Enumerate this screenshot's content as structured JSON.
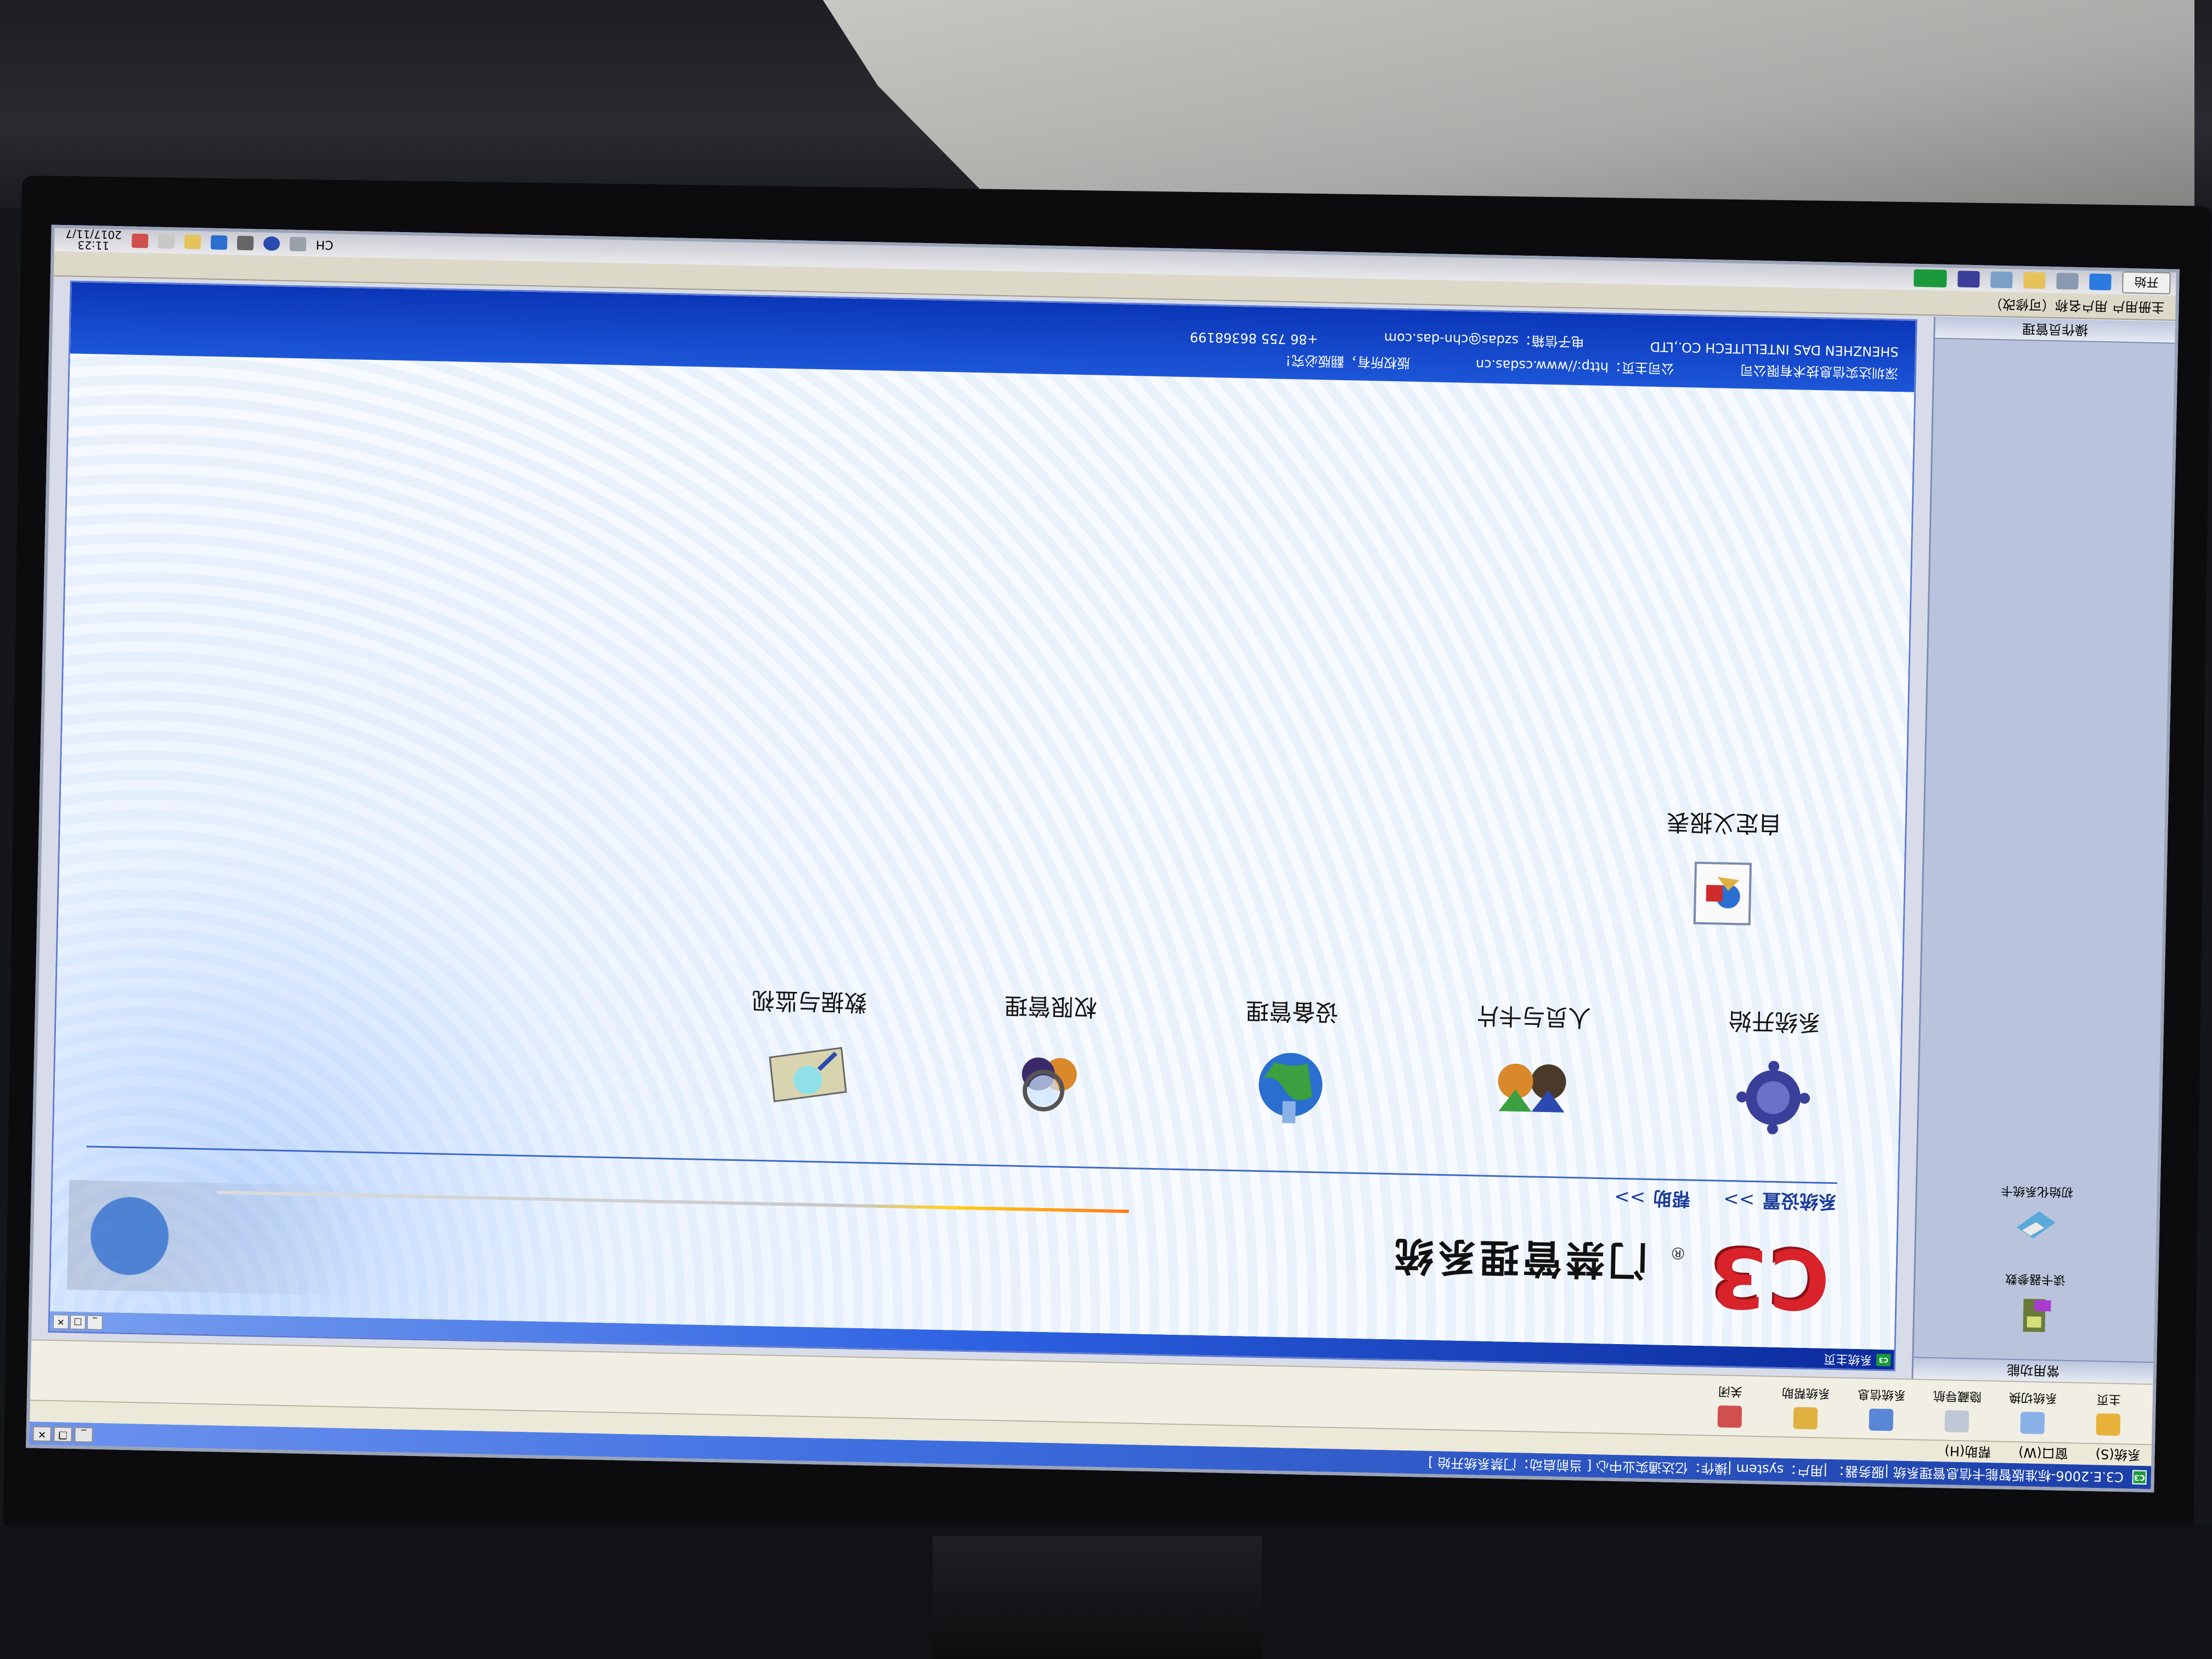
{
  "app": {
    "title": "C3.E.2006-标准版智能卡信息管理系统  |服务器：  |用户：system  |操作：亿达通实业中心    [ 当前启动：门禁系统开始 ]",
    "logo_text": "C3"
  },
  "menu": [
    "系统(S)",
    "窗口(W)",
    "帮助(H)"
  ],
  "toolbar": [
    {
      "label": "主页",
      "icon": "home-icon",
      "color": "#e6b23a"
    },
    {
      "label": "系统切换",
      "icon": "switch-icon",
      "color": "#8ab0e8"
    },
    {
      "label": "隐藏导航",
      "icon": "hide-nav-icon",
      "color": "#c0c8d6"
    },
    {
      "label": "系统信息",
      "icon": "info-icon",
      "color": "#5a86d8"
    },
    {
      "label": "系统帮助",
      "icon": "help-icon",
      "color": "#e0b040"
    },
    {
      "label": "关闭",
      "icon": "close-icon",
      "color": "#d05050"
    }
  ],
  "sidebar": {
    "header": "常用功能",
    "items": [
      {
        "label": "读卡器参数",
        "icon": "card-reader-icon"
      },
      {
        "label": "初始化系统卡",
        "icon": "init-card-icon"
      }
    ],
    "footer": "操作员管理"
  },
  "mdi": {
    "title": "系统主页"
  },
  "header": {
    "brand": "C3",
    "registered": "®",
    "system_name": "门禁管理系统",
    "nav": [
      {
        "label": "系统设置",
        "arrow": ">>"
      },
      {
        "label": "帮助",
        "arrow": ">>"
      }
    ]
  },
  "modules": [
    {
      "label": "系统开始",
      "icon": "virus-gear-icon"
    },
    {
      "label": "人员与卡片",
      "icon": "people-icon"
    },
    {
      "label": "设备管理",
      "icon": "globe-icon"
    },
    {
      "label": "权限管理",
      "icon": "magnifier-people-icon"
    },
    {
      "label": "数据与监视",
      "icon": "monitor-data-icon"
    }
  ],
  "custom_report": {
    "label": "自定义报表",
    "icon": "report-icon"
  },
  "footer": {
    "company": "深圳达实信息技术有限公司",
    "company_en": "SHENZHEN DAS INTELLITECH CO.,LTD",
    "website_label": "公司主页：",
    "website": "http://www.csdas.cn",
    "email_label": "电子信箱：",
    "email": "szdas@chn-das.com",
    "copyright": "版权所有，翻版必究！",
    "phone": "+86 755 86368199"
  },
  "taskbar": {
    "start": "开始",
    "status_hint": "主册用户 用户名称（可修改）",
    "input_method": "CH",
    "time": "11:23",
    "date": "2017/11/7"
  },
  "colors": {
    "brand_red": "#d8232a",
    "title_blue": "#2d62e3",
    "footer_blue": "#0b36b8"
  }
}
